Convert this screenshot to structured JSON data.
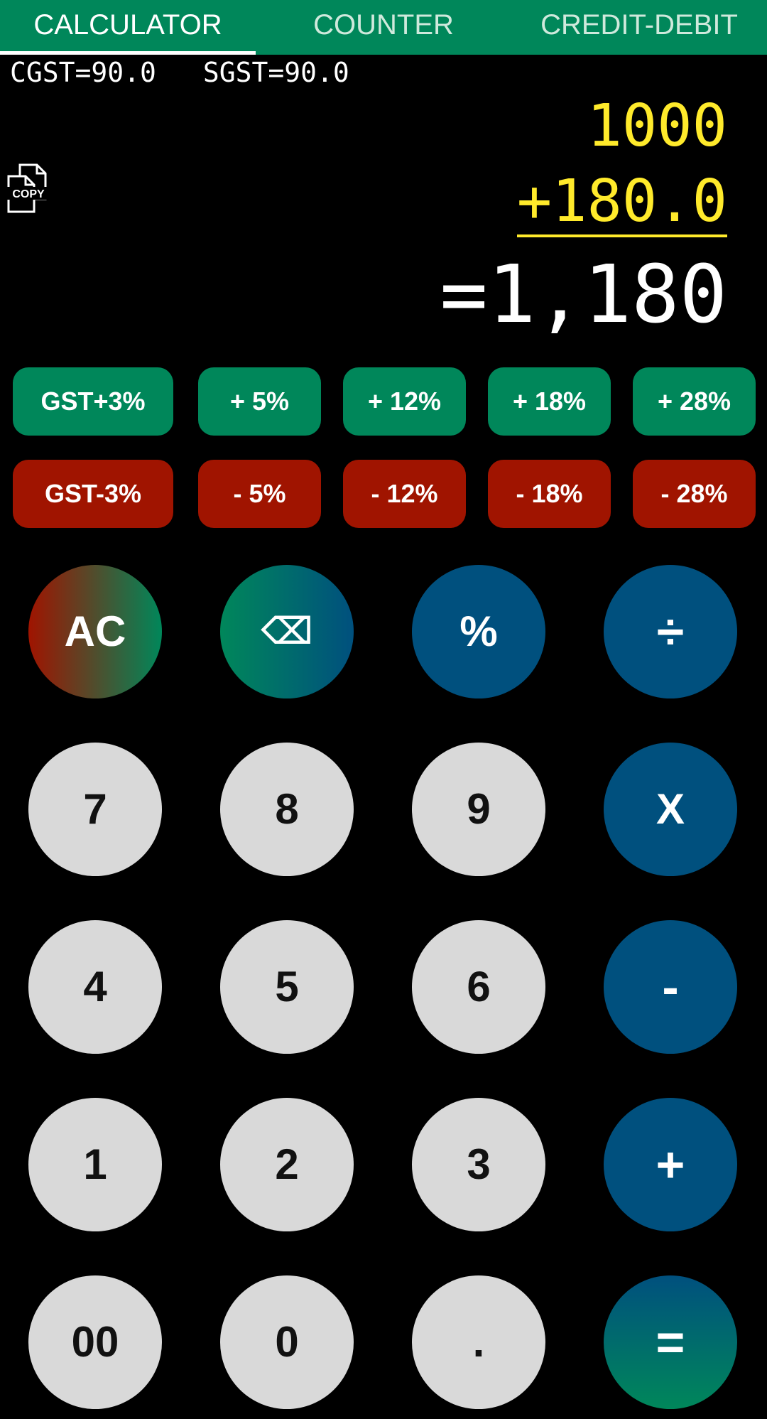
{
  "tabs": [
    {
      "label": "CALCULATOR",
      "active": true
    },
    {
      "label": "COUNTER",
      "active": false
    },
    {
      "label": "CREDIT-DEBIT",
      "active": false
    }
  ],
  "gst_info": {
    "cgst": "CGST=90.0",
    "sgst": "SGST=90.0"
  },
  "copy_icon": {
    "icon": "copy-icon",
    "label": "COPY"
  },
  "display": {
    "operand": "1000",
    "delta": "+180.0",
    "result": "=1,180"
  },
  "gst_add": [
    "GST+3%",
    "+ 5%",
    "+ 12%",
    "+ 18%",
    "+ 28%"
  ],
  "gst_sub": [
    "GST-3%",
    "- 5%",
    "- 12%",
    "- 18%",
    "- 28%"
  ],
  "keys": {
    "ac": "AC",
    "backspace": "⌫",
    "percent": "%",
    "divide": "÷",
    "seven": "7",
    "eight": "8",
    "nine": "9",
    "multiply": "X",
    "four": "4",
    "five": "5",
    "six": "6",
    "minus": "-",
    "one": "1",
    "two": "2",
    "three": "3",
    "plus": "+",
    "double_zero": "00",
    "zero": "0",
    "dot": ".",
    "equals": "="
  },
  "colors": {
    "tab_bar": "#00875a",
    "accent_green": "#00875a",
    "accent_red": "#a01400",
    "operator_blue": "#00507e",
    "display_yellow": "#ffea2b",
    "number_key": "#d9d9d9"
  }
}
